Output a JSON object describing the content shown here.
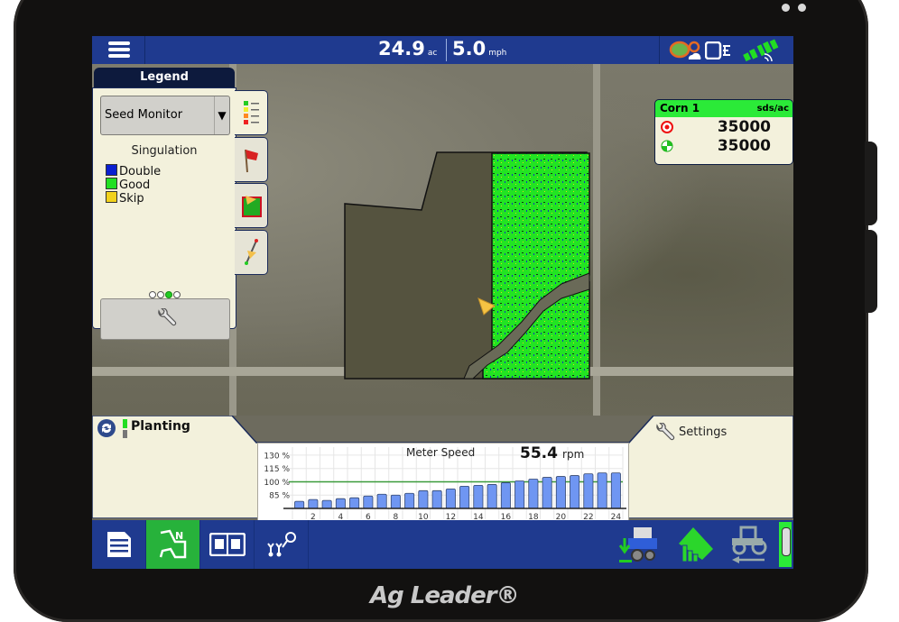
{
  "device": {
    "brand": "Ag Leader®"
  },
  "topbar": {
    "area_value": "24.9",
    "area_unit": "ac",
    "speed_value": "5.0",
    "speed_unit": "mph",
    "icons": [
      "menu-icon",
      "satellite-weather-icon",
      "display-link-icon",
      "gps-satellite-icon"
    ]
  },
  "legend": {
    "title": "Legend",
    "dropdown_value": "Seed Monitor",
    "section_title": "Singulation",
    "items": [
      {
        "label": "Double",
        "color": "#0a1fd0"
      },
      {
        "label": "Good",
        "color": "#22e022"
      },
      {
        "label": "Skip",
        "color": "#f2d21c"
      }
    ],
    "page_count": 4,
    "page_active": 3,
    "tabs": [
      "legend-tab",
      "flags-tab",
      "field-ops-tab",
      "guidance-tab"
    ]
  },
  "product": {
    "name": "Corn 1",
    "unit": "sds/ac",
    "target_rate": "35000",
    "actual_rate": "35000",
    "header_color": "#2bea38"
  },
  "bottom": {
    "planting_label": "Planting",
    "settings_label": "Settings"
  },
  "chart_data": {
    "type": "bar",
    "title": "Meter Speed",
    "readout_value": "55.4",
    "readout_unit": "rpm",
    "ytick_labels": [
      "130 %",
      "115 %",
      "100 %",
      "85 %"
    ],
    "yticks": [
      130,
      115,
      100,
      85
    ],
    "ylim": [
      70,
      135
    ],
    "reference_line": 100,
    "xtick_labels": [
      "2",
      "4",
      "6",
      "8",
      "10",
      "12",
      "14",
      "16",
      "18",
      "20",
      "22",
      "24"
    ],
    "categories": [
      1,
      2,
      3,
      4,
      5,
      6,
      7,
      8,
      9,
      10,
      11,
      12,
      13,
      14,
      15,
      16,
      17,
      18,
      19,
      20,
      21,
      22,
      23,
      24
    ],
    "values": [
      78,
      80,
      79,
      81,
      82,
      84,
      86,
      85,
      87,
      90,
      90,
      92,
      95,
      96,
      97,
      99,
      101,
      103,
      105,
      106,
      107,
      109,
      110,
      110
    ],
    "bar_color": "#6f96f2",
    "line_color": "#3a9a3a",
    "page_count": 8,
    "page_active": 2
  },
  "bottombar": {
    "left_buttons": [
      "summary-icon",
      "field-map-icon",
      "split-screen-icon",
      "planter-row-icon"
    ],
    "active_index": 1,
    "right_buttons": [
      "planter-config-icon",
      "field-ops-icon",
      "tractor-reverse-icon"
    ]
  }
}
